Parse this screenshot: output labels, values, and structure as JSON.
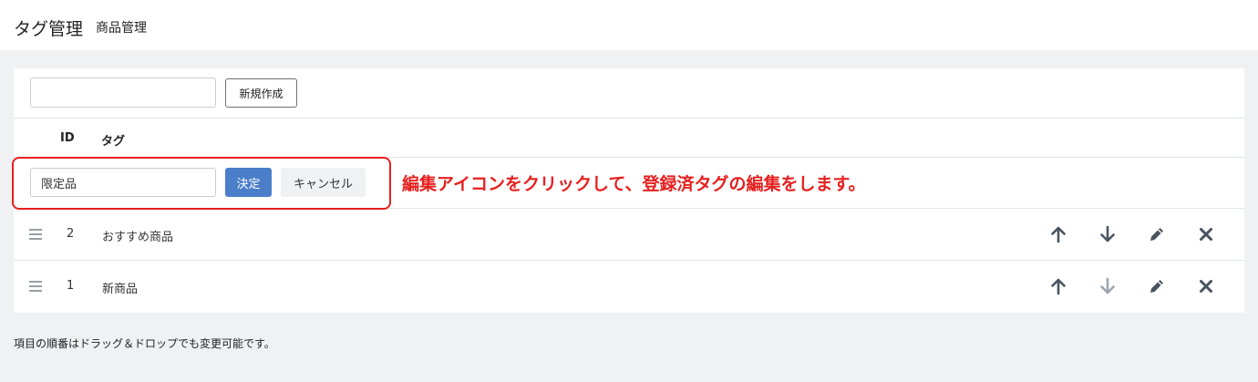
{
  "header": {
    "title": "タグ管理",
    "subtitle": "商品管理"
  },
  "create": {
    "input_value": "",
    "button_label": "新規作成"
  },
  "table": {
    "columns": [
      "ID",
      "タグ"
    ],
    "editing": {
      "value": "限定品",
      "confirm_label": "決定",
      "cancel_label": "キャンセル"
    },
    "rows": [
      {
        "id": "2",
        "name": "おすすめ商品",
        "down_enabled": true
      },
      {
        "id": "1",
        "name": "新商品",
        "down_enabled": false
      }
    ]
  },
  "icons": [
    "drag-handle-icon",
    "arrow-up-icon",
    "arrow-down-icon",
    "pencil-icon",
    "close-icon"
  ],
  "colors": {
    "primary": "#4a7ec9",
    "annotation": "#e6201f",
    "icon": "#4a5460",
    "icon_disabled": "#9aa5b1"
  },
  "annotation": {
    "text": "編集アイコンをクリックして、登録済タグの編集をします。"
  },
  "footer_note": "項目の順番はドラッグ＆ドロップでも変更可能です。"
}
